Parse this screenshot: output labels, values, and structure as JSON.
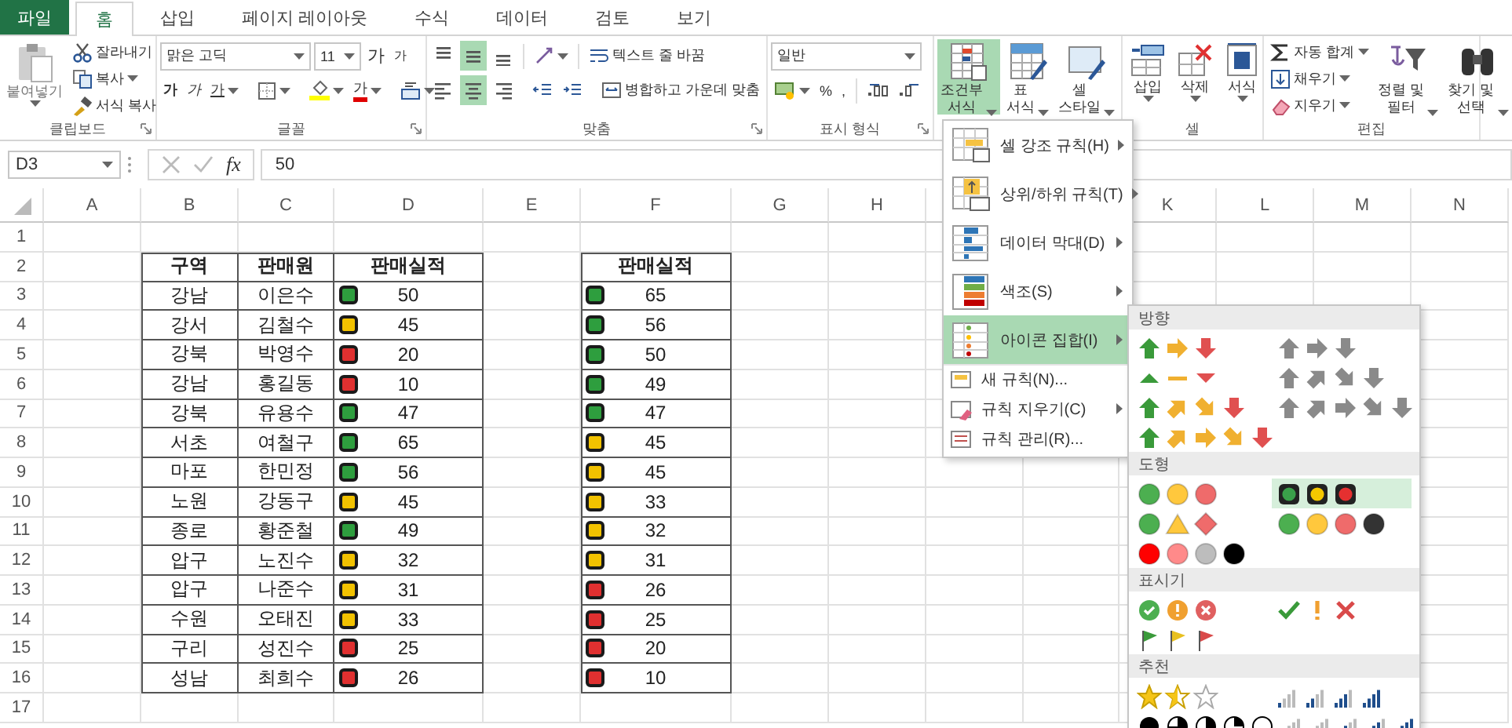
{
  "tabs": [
    {
      "label": "파일",
      "kind": "file",
      "selected": false
    },
    {
      "label": "홈",
      "kind": "tab",
      "selected": true
    },
    {
      "label": "삽입",
      "kind": "tab",
      "selected": false
    },
    {
      "label": "페이지 레이아웃",
      "kind": "tab",
      "selected": false
    },
    {
      "label": "수식",
      "kind": "tab",
      "selected": false
    },
    {
      "label": "데이터",
      "kind": "tab",
      "selected": false
    },
    {
      "label": "검토",
      "kind": "tab",
      "selected": false
    },
    {
      "label": "보기",
      "kind": "tab",
      "selected": false
    }
  ],
  "ribbon": {
    "clipboard": {
      "paste": "붙여넣기",
      "cut": "잘라내기",
      "copy": "복사",
      "format_painter": "서식 복사",
      "label": "클립보드"
    },
    "font": {
      "font_name": "맑은 고딕",
      "font_size": "11",
      "grow": "가",
      "shrink": "가",
      "bold": "가",
      "italic": "가",
      "underline": "가",
      "font_color": "가",
      "label": "글꼴"
    },
    "alignment": {
      "vertical": [
        {
          "selected": false
        },
        {
          "selected": true
        },
        {
          "selected": false
        }
      ],
      "horizontal": [
        {
          "selected": false
        },
        {
          "selected": true
        },
        {
          "selected": false
        }
      ],
      "wrap_text": "텍스트 줄 바꿈",
      "merge_center": "병합하고 가운데 맞춤",
      "label": "맞춤"
    },
    "number": {
      "format": "일반",
      "percent": "%",
      "comma": ",",
      "label": "표시 형식"
    },
    "styles": [
      {
        "label": "조건부\n서식",
        "selected": true
      },
      {
        "label": "표\n서식",
        "selected": false
      },
      {
        "label": "셀\n스타일",
        "selected": false
      }
    ],
    "cells": {
      "buttons": [
        "삽입",
        "삭제",
        "서식"
      ],
      "label": "셀"
    },
    "editing": {
      "autosum": "자동 합계",
      "fill": "채우기",
      "clear": "지우기",
      "sort_filter": "정렬 및\n필터",
      "find_select": "찾기 및\n선택",
      "label": "편집"
    }
  },
  "formula_bar": {
    "name_box": "D3",
    "insert_function": "fx",
    "formula": "50"
  },
  "sheet": {
    "columns": [
      "A",
      "B",
      "C",
      "D",
      "E",
      "F",
      "G",
      "H",
      "K",
      "L",
      "M",
      "N"
    ],
    "rows": [
      "1",
      "2",
      "3",
      "4",
      "5",
      "6",
      "7",
      "8",
      "9",
      "10",
      "11",
      "12",
      "13",
      "14",
      "15",
      "16",
      "17"
    ],
    "table1": {
      "headers": [
        "구역",
        "판매원",
        "판매실적"
      ],
      "rows": [
        {
          "district": "강남",
          "seller": "이은수",
          "value": "50",
          "color": "#2e9e3e"
        },
        {
          "district": "강서",
          "seller": "김철수",
          "value": "45",
          "color": "#f2c200"
        },
        {
          "district": "강북",
          "seller": "박영수",
          "value": "20",
          "color": "#e03030"
        },
        {
          "district": "강남",
          "seller": "홍길동",
          "value": "10",
          "color": "#e03030"
        },
        {
          "district": "강북",
          "seller": "유용수",
          "value": "47",
          "color": "#2e9e3e"
        },
        {
          "district": "서초",
          "seller": "여철구",
          "value": "65",
          "color": "#2e9e3e"
        },
        {
          "district": "마포",
          "seller": "한민정",
          "value": "56",
          "color": "#2e9e3e"
        },
        {
          "district": "노원",
          "seller": "강동구",
          "value": "45",
          "color": "#f2c200"
        },
        {
          "district": "종로",
          "seller": "황준철",
          "value": "49",
          "color": "#2e9e3e"
        },
        {
          "district": "압구",
          "seller": "노진수",
          "value": "32",
          "color": "#f2c200"
        },
        {
          "district": "압구",
          "seller": "나준수",
          "value": "31",
          "color": "#f2c200"
        },
        {
          "district": "수원",
          "seller": "오태진",
          "value": "33",
          "color": "#f2c200"
        },
        {
          "district": "구리",
          "seller": "성진수",
          "value": "25",
          "color": "#e03030"
        },
        {
          "district": "성남",
          "seller": "최희수",
          "value": "26",
          "color": "#e03030"
        }
      ]
    },
    "table2": {
      "header": "판매실적",
      "rows": [
        {
          "value": "65",
          "color": "#2e9e3e"
        },
        {
          "value": "56",
          "color": "#2e9e3e"
        },
        {
          "value": "50",
          "color": "#2e9e3e"
        },
        {
          "value": "49",
          "color": "#2e9e3e"
        },
        {
          "value": "47",
          "color": "#2e9e3e"
        },
        {
          "value": "45",
          "color": "#f2c200"
        },
        {
          "value": "45",
          "color": "#f2c200"
        },
        {
          "value": "33",
          "color": "#f2c200"
        },
        {
          "value": "32",
          "color": "#f2c200"
        },
        {
          "value": "31",
          "color": "#f2c200"
        },
        {
          "value": "26",
          "color": "#e03030"
        },
        {
          "value": "25",
          "color": "#e03030"
        },
        {
          "value": "20",
          "color": "#e03030"
        },
        {
          "value": "10",
          "color": "#e03030"
        }
      ]
    }
  },
  "conditional_menu": {
    "items": [
      {
        "label": "셀 강조 규칙(H)",
        "kind": "large",
        "submenu": true,
        "selected": false
      },
      {
        "label": "상위/하위 규칙(T)",
        "kind": "large",
        "submenu": true,
        "selected": false
      },
      {
        "label": "데이터 막대(D)",
        "kind": "large",
        "submenu": true,
        "selected": false
      },
      {
        "label": "색조(S)",
        "kind": "large",
        "submenu": true,
        "selected": false
      },
      {
        "label": "아이콘 집합(I)",
        "kind": "large",
        "submenu": true,
        "selected": true
      },
      {
        "label": "새 규칙(N)...",
        "kind": "small",
        "submenu": false,
        "selected": false
      },
      {
        "label": "규칙 지우기(C)",
        "kind": "small",
        "submenu": true,
        "selected": false
      },
      {
        "label": "규칙 관리(R)...",
        "kind": "small",
        "submenu": false,
        "selected": false
      }
    ]
  },
  "icon_sets": {
    "sections": [
      {
        "title": "방향",
        "sets": [
          {
            "kind": "arrows3-color",
            "selected": false
          },
          {
            "kind": "arrows3-gray",
            "selected": false
          },
          {
            "kind": "triangles3",
            "selected": false
          },
          {
            "kind": "arrows4-gray",
            "selected": false
          },
          {
            "kind": "arrows4-color",
            "selected": false
          },
          {
            "kind": "arrows5-gray",
            "selected": false
          },
          {
            "kind": "arrows5-color",
            "selected": false
          }
        ]
      },
      {
        "title": "도형",
        "sets": [
          {
            "kind": "lights3",
            "selected": false
          },
          {
            "kind": "lights3-rimmed",
            "selected": true
          },
          {
            "kind": "signs3",
            "selected": false
          },
          {
            "kind": "lights4",
            "selected": false
          },
          {
            "kind": "redblack4",
            "selected": false
          }
        ]
      },
      {
        "title": "표시기",
        "sets": [
          {
            "kind": "symbols3-circled",
            "selected": false
          },
          {
            "kind": "symbols3",
            "selected": false
          },
          {
            "kind": "flags3",
            "selected": false
          }
        ]
      },
      {
        "title": "추천",
        "sets": [
          {
            "kind": "stars3",
            "selected": false
          },
          {
            "kind": "bars4",
            "selected": false
          },
          {
            "kind": "quarters5",
            "selected": false
          },
          {
            "kind": "bars5",
            "selected": false
          }
        ]
      }
    ]
  }
}
